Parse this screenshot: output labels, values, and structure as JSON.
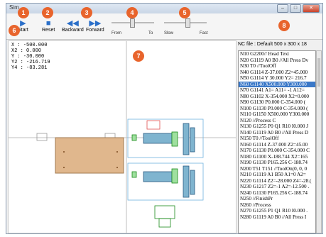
{
  "window": {
    "title": "Sim..."
  },
  "toolbar": {
    "start_label": "Start",
    "reset_label": "Reset",
    "backward_label": "Backward",
    "forward_label": "Forward",
    "from_label": "From",
    "to_label": "To",
    "slow_label": "Slow",
    "fast_label": "Fast"
  },
  "markers": [
    "1",
    "2",
    "3",
    "4",
    "5",
    "6",
    "7",
    "8"
  ],
  "coords": {
    "x": "X : -500.000",
    "x2": "X2 : 0.000",
    "y": "Y : -30.000",
    "y2": "Y2 : -216.719",
    "y4": "Y4 : -83.281"
  },
  "nc": {
    "title": "NC file : Default 500 x 300 x 18",
    "lines": [
      "N10 G2200// Head Text",
      "N20 G1119 A0 B0 //All Press Dv",
      "N30 T0 //ToolOff",
      "N40 G1114 Z-37.000 Z2=45.000",
      "N50 G1114 Y 30.000 Y2= 216.7",
      "N60 G1140 X500.000 Y300.000",
      "N70 G1141 A1= A11= -1 A12=",
      "N80 G1102 X-354.000 X2=0.000",
      "N90 G1130 P0.000 C-354.000 (",
      "N100 G1130 P0.000 C-354.000 (",
      "N110 G1150 X500.000 Y300.000",
      "N120                //Process C",
      "N130 G1255 P0 Q1 R10 I0.000 J",
      "N140 G1119 A0 B0 //All Press D",
      "N150 T0 //ToolOff",
      "N160 G1114 Z-37.000 Z2=45.00",
      "N170 G1130 P0.000 C-354.000 C",
      "N180 G1100 X-188.744 X2=165",
      "N190 G1130 P165.256 C-188.74",
      "N200 T51 T151 //ToolOn(0, 0, 0",
      "N210 G1119 A1 B50 A1=0 A2=",
      "N220 G1114 Z2=-28.000 Z4=-28.(",
      "N230 G1217 Z2=-1 A2=-12.500 .",
      "N240 G1130 P165.256 C-188.74",
      "N250                //FinishPr",
      "N260                //Process",
      "N270 G1255 P1 Q1 R10 I0.000 .",
      "N280 G1119 A0 B0 //All Press I"
    ],
    "selected_index": 5
  }
}
